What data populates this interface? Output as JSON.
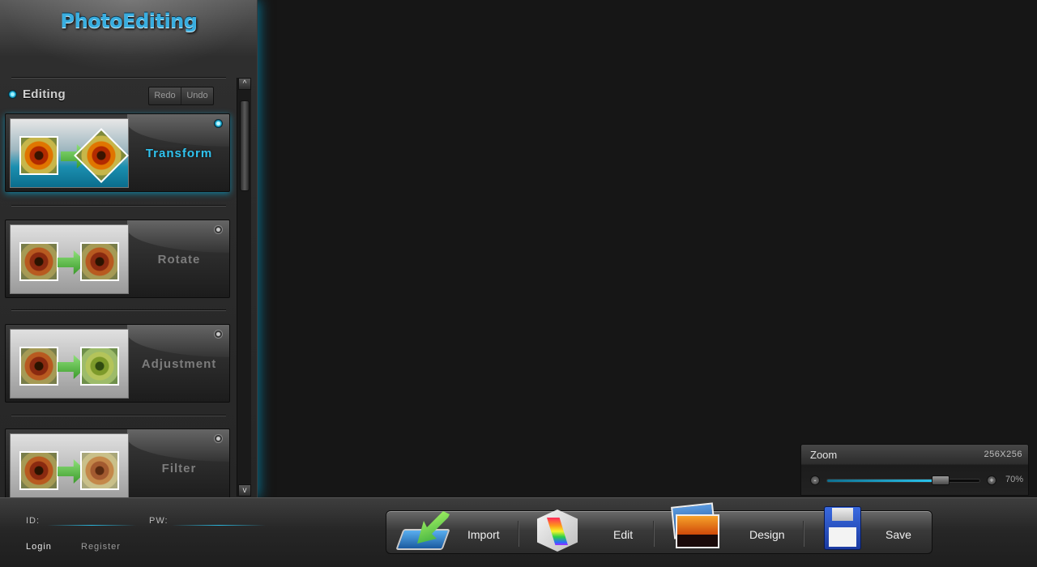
{
  "app": {
    "logo": "PhotoEditing"
  },
  "sidebar": {
    "section_title": "Editing",
    "redo_label": "Redo",
    "undo_label": "Undo",
    "tools": [
      {
        "label": "Transform",
        "active": true
      },
      {
        "label": "Rotate",
        "active": false
      },
      {
        "label": "Adjustment",
        "active": false
      },
      {
        "label": "Filter",
        "active": false
      }
    ],
    "scroll_up": "^",
    "scroll_down": "v"
  },
  "login": {
    "id_label": "ID:",
    "pw_label": "PW:",
    "id_value": "",
    "pw_value": "",
    "login_label": "Login",
    "register_label": "Register"
  },
  "actions": [
    {
      "label": "Import",
      "icon": "import-icon"
    },
    {
      "label": "Edit",
      "icon": "edit-icon"
    },
    {
      "label": "Design",
      "icon": "design-icon"
    },
    {
      "label": "Save",
      "icon": "save-icon"
    }
  ],
  "zoom": {
    "title": "Zoom",
    "size": "256X256",
    "level_percent": 70,
    "level_label": "70%",
    "minus": "-",
    "plus": "+"
  },
  "colors": {
    "accent": "#2bc6ef",
    "background": "#161616"
  }
}
